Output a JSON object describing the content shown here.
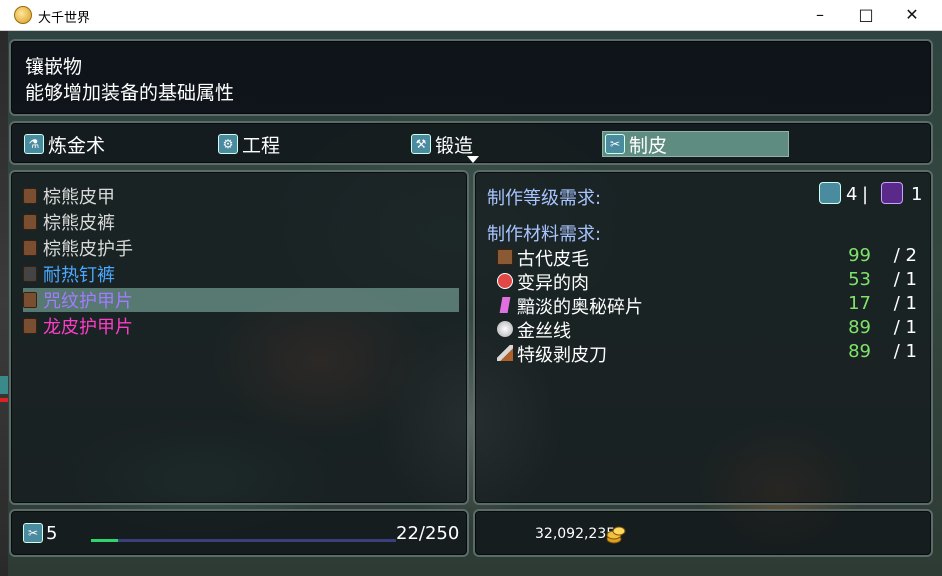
{
  "window": {
    "title": "大千世界",
    "minimize": "–",
    "maximize": "□",
    "close": "✕",
    "icon": "app-coin-icon"
  },
  "description": {
    "title": "镶嵌物",
    "text": "能够增加装备的基础属性"
  },
  "tabs": [
    {
      "label": "炼金术",
      "icon": "alchemy-icon",
      "glyph": "⚗"
    },
    {
      "label": "工程",
      "icon": "engineering-icon",
      "glyph": "⚙"
    },
    {
      "label": "锻造",
      "icon": "smithing-icon",
      "glyph": "⚒"
    },
    {
      "label": "制皮",
      "icon": "leatherworking-icon",
      "glyph": "✂",
      "active": true
    }
  ],
  "recipes": [
    {
      "name": "棕熊皮甲",
      "color": "grey"
    },
    {
      "name": "棕熊皮裤",
      "color": "grey"
    },
    {
      "name": "棕熊皮护手",
      "color": "grey"
    },
    {
      "name": "耐热钉裤",
      "color": "blue"
    },
    {
      "name": "咒纹护甲片",
      "color": "violet",
      "selected": true
    },
    {
      "name": "龙皮护甲片",
      "color": "pink"
    }
  ],
  "requirements": {
    "level_label": "制作等级需求:",
    "skill_level": "4",
    "separator": "|",
    "rank_level": "1",
    "materials_label": "制作材料需求:",
    "materials": [
      {
        "name": "古代皮毛",
        "have": "99",
        "need": "/ 2",
        "icon": "fur-icon"
      },
      {
        "name": "变异的肉",
        "have": "53",
        "need": "/ 1",
        "icon": "meat-icon"
      },
      {
        "name": "黯淡的奥秘碎片",
        "have": "17",
        "need": "/ 1",
        "icon": "arcane-shard-icon"
      },
      {
        "name": "金丝线",
        "have": "89",
        "need": "/ 1",
        "icon": "thread-icon"
      },
      {
        "name": "特级剥皮刀",
        "have": "89",
        "need": "/ 1",
        "icon": "skinning-knife-icon"
      }
    ]
  },
  "status": {
    "profession_level": "5",
    "progress_text": "22/250",
    "progress_fraction": 0.088,
    "gold": "32,092,235"
  }
}
